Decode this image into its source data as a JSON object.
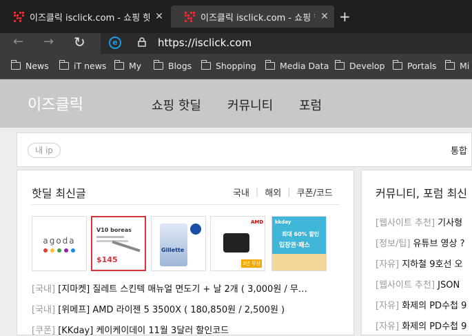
{
  "tabs": [
    {
      "title": "이즈클릭 isclick.com - 쇼핑 핫딜",
      "active": false
    },
    {
      "title": "이즈클릭 isclick.com - 쇼핑 핫딜",
      "active": true
    }
  ],
  "new_tab_glyph": "+",
  "close_glyph": "✕",
  "address": {
    "url": "https://isclick.com"
  },
  "nav": {
    "back_glyph": "←",
    "forward_glyph": "→",
    "refresh_glyph": "↻"
  },
  "bookmarks": [
    "News",
    "iT news",
    "My",
    "Blogs",
    "Shopping",
    "Media Data",
    "Develop",
    "Portals",
    "Mi"
  ],
  "site": {
    "logo": "이즈클릭",
    "menu": [
      "쇼핑 핫딜",
      "커뮤니티",
      "포럼"
    ],
    "ip_badge": "내 ip",
    "integrated_search": "통합"
  },
  "deals": {
    "title": "핫딜 최신글",
    "tabs": [
      "국내",
      "해외",
      "쿠폰/코드"
    ],
    "thumbs": [
      {
        "label": "agoda"
      },
      {
        "label": "V10 boreas",
        "price": "$145"
      },
      {
        "label": "Gillette"
      },
      {
        "label": "AMD",
        "badge": "3년 무상"
      },
      {
        "label": "kkday",
        "promo": "최대 60% 할인",
        "promo2": "입장권·패스"
      }
    ],
    "items": [
      {
        "cat": "[국내]",
        "text": " [지마켓] 질레트 스킨텍 매뉴얼 면도기 + 날 2개 ( 3,000원 / 무…"
      },
      {
        "cat": "[국내]",
        "text": " [위메프] AMD 라이젠 5 3500X ( 180,850원 / 2,500원 )"
      },
      {
        "cat": "[쿠폰]",
        "text": " [KKday] 케이케이데이 11월 3달러 할인코드"
      }
    ]
  },
  "community": {
    "title": "커뮤니티, 포럼 최신",
    "items": [
      {
        "cat": "[웹사이트 추천]",
        "text": " 기사형"
      },
      {
        "cat": "[정보/팁]",
        "text": " 유튜브 영상 ?"
      },
      {
        "cat": "[자유]",
        "text": " 지하철 9호선 오"
      },
      {
        "cat": "[웹사이트 추천]",
        "text": " JSON "
      },
      {
        "cat": "[자유]",
        "text": " 화제의 PD수첩 9"
      },
      {
        "cat": "[자유]",
        "text": " 화제의 PD수첩 9"
      }
    ]
  },
  "colors": {
    "accent": "#d6323a",
    "ie_blue": "#1e9be8",
    "header_gray": "#c8c8c8"
  }
}
